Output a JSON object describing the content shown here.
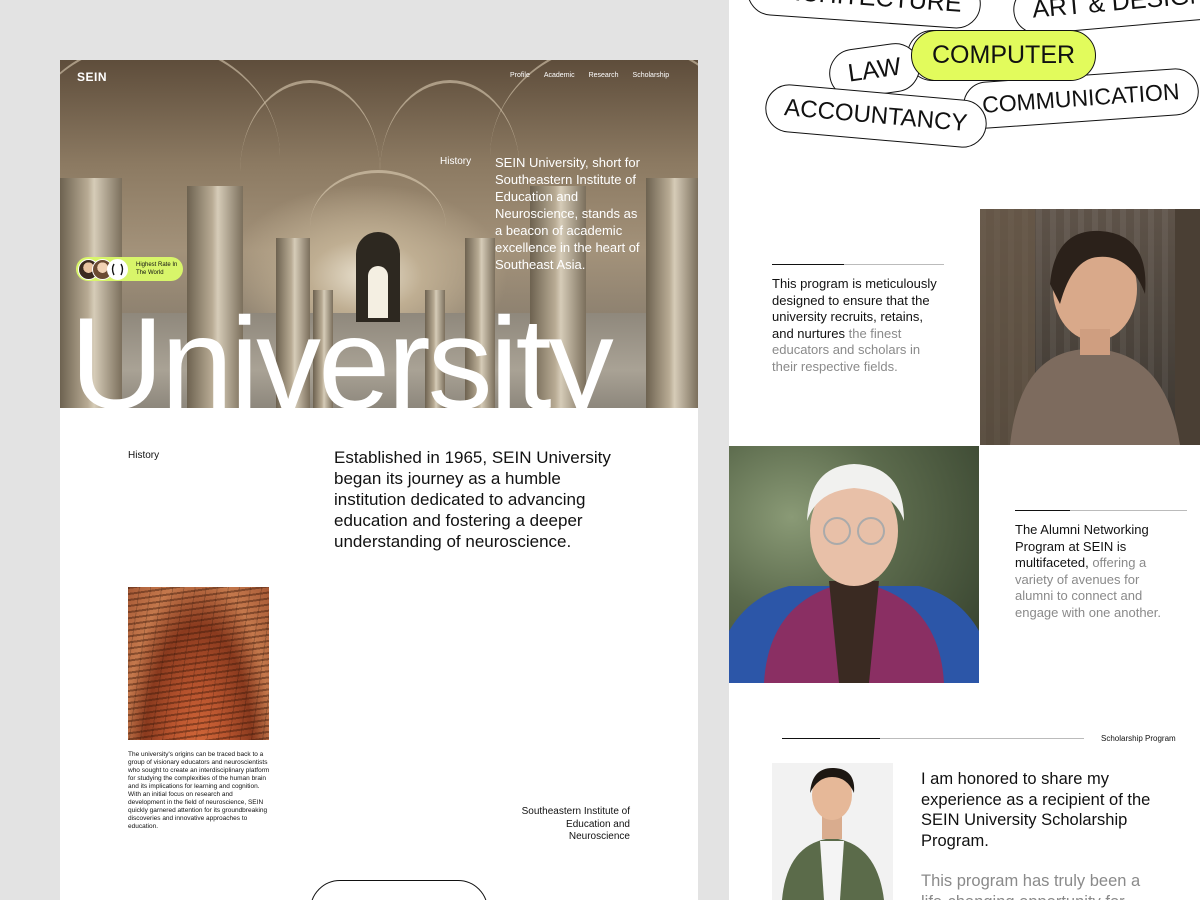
{
  "left": {
    "logo": "SEIN",
    "nav": [
      "Profile",
      "Academic",
      "Research",
      "Scholarship"
    ],
    "hero": {
      "history_label": "History",
      "description": "SEIN University, short for Southeastern Institute of Education and Neuroscience, stands as a beacon of academic excellence in the heart of Southeast Asia.",
      "rate_badge": "Highest Rate In The World",
      "big_word": "University"
    },
    "history": {
      "label": "History",
      "body": "Established in 1965, SEIN University began its journey as a humble institution dedicated to advancing education and fostering a deeper understanding of neuroscience."
    },
    "origins_text": "The university's origins can be traced back to a group of visionary educators and neuroscientists who sought to create an interdisciplinary platform for studying the complexities of the human brain and its implications for learning and cognition. With an initial focus on research and development in the field of neuroscience, SEIN quickly garnered attention for its groundbreaking discoveries and innovative approaches to education.",
    "institution_name": "Southeastern Institute of Education and Neuroscience"
  },
  "right": {
    "chips": {
      "architecture": "ARCHITECTURE",
      "art_design": "ART & DESIGN",
      "law": "LAW",
      "computer": "COMPUTER",
      "accountancy": "ACCOUNTANCY",
      "communication": "COMMUNICATION"
    },
    "program": {
      "strong": "This program is meticulously designed to ensure that the university recruits, retains, and nurtures",
      "muted": " the finest educators and scholars in their respective fields."
    },
    "alumni": {
      "strong": "The Alumni Networking Program at SEIN is multifaceted,",
      "muted": " offering a variety of avenues for alumni to connect and engage with one another."
    },
    "scholarship": {
      "label": "Scholarship Program",
      "quote": "I am honored to share my experience as a recipient of the SEIN University Scholarship Program.",
      "quote_more": "This program has truly been a life-changing opportunity for"
    }
  },
  "colors": {
    "accent": "#e2fb5c",
    "badge": "#d8f56a",
    "page_bg": "#e3e3e3",
    "muted_text": "#8a8a8a"
  }
}
